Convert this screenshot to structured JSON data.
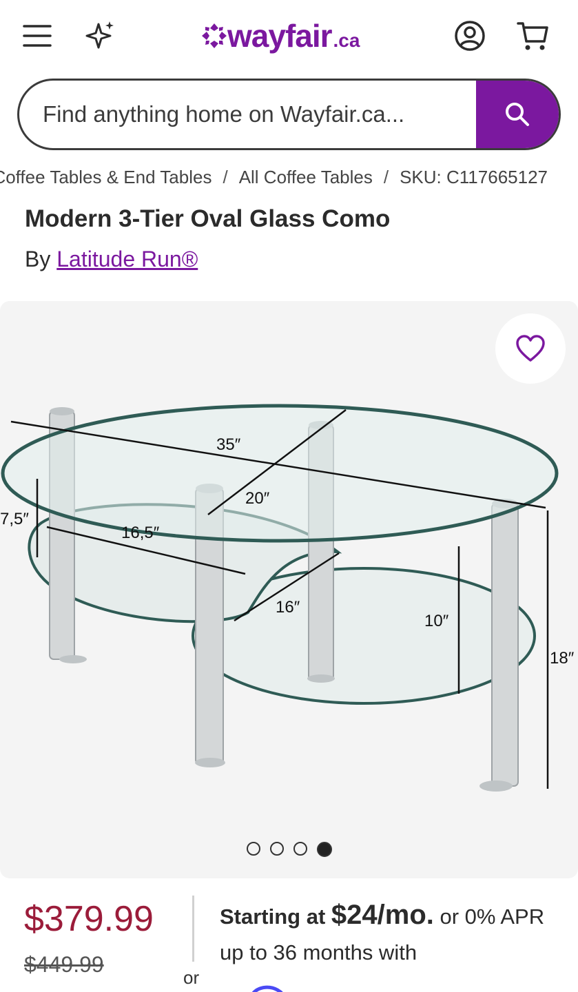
{
  "header": {
    "logo_text": "wayfair",
    "logo_suffix": ".ca",
    "brand_color": "#7b189f",
    "icons": [
      "menu-icon",
      "sparkle-icon",
      "account-icon",
      "cart-icon"
    ]
  },
  "search": {
    "placeholder": "Find anything home on Wayfair.ca..."
  },
  "breadcrumb": {
    "items": [
      "Coffee Tables & End Tables",
      "All Coffee Tables",
      "SKU: C117665127"
    ],
    "separator": "/"
  },
  "product": {
    "title": "Modern 3-Tier Oval Glass Como",
    "by_label": "By",
    "brand": "Latitude Run®"
  },
  "gallery": {
    "dimensions": {
      "length": "35″",
      "width": "20″",
      "tier_height": "7,5″",
      "small_shelf": "16,5″",
      "small_depth": "16″",
      "lower_gap": "10″",
      "total_height": "18″"
    },
    "slide_count": 4,
    "active_slide": 4
  },
  "pricing": {
    "price": "$379.99",
    "old_price": "$449.99",
    "or_label": "or",
    "financing_prefix": "Starting at ",
    "financing_amount": "$24/mo.",
    "financing_suffix": " or 0% APR up to 36 months with",
    "price_color": "#9b1c3a"
  }
}
